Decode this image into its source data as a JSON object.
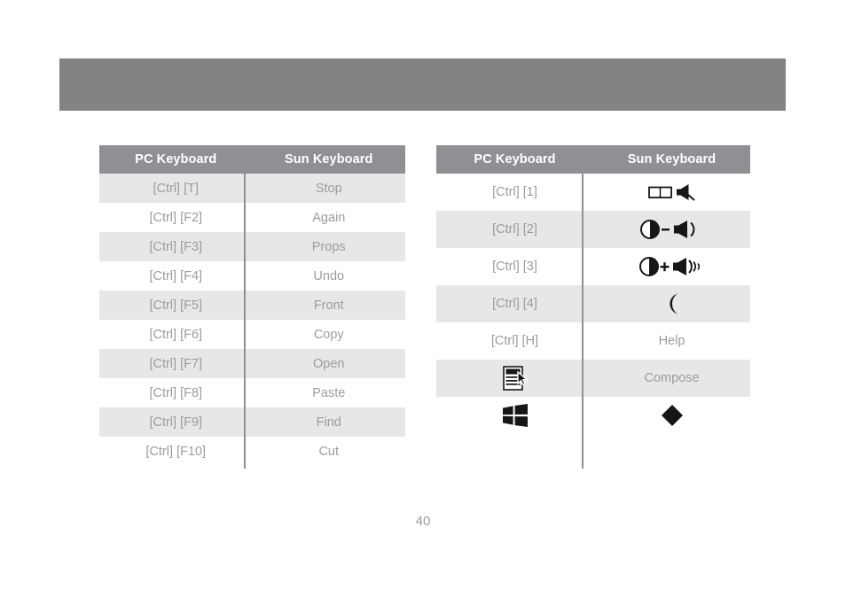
{
  "page": {
    "number": "40",
    "banner_color": "#818480",
    "header_bg": "#8e9094",
    "stripe_color": "#e5e7e9",
    "text_color": "#9c9c9c"
  },
  "tables": {
    "left": {
      "headers": [
        "PC Keyboard",
        "Sun Keyboard"
      ],
      "rows": [
        {
          "pc": "[Ctrl] [T]",
          "sun": "Stop"
        },
        {
          "pc": "[Ctrl] [F2]",
          "sun": "Again"
        },
        {
          "pc": "[Ctrl] [F3]",
          "sun": "Props"
        },
        {
          "pc": "[Ctrl] [F4]",
          "sun": "Undo"
        },
        {
          "pc": "[Ctrl] [F5]",
          "sun": "Front"
        },
        {
          "pc": "[Ctrl] [F6]",
          "sun": "Copy"
        },
        {
          "pc": "[Ctrl] [F7]",
          "sun": "Open"
        },
        {
          "pc": "[Ctrl] [F8]",
          "sun": "Paste"
        },
        {
          "pc": "[Ctrl] [F9]",
          "sun": "Find"
        },
        {
          "pc": "[Ctrl] [F10]",
          "sun": "Cut"
        }
      ]
    },
    "right": {
      "headers": [
        "PC Keyboard",
        "Sun Keyboard"
      ],
      "rows": [
        {
          "pc": "[Ctrl] [1]",
          "pc_icon": "",
          "sun": "",
          "sun_icon": "mute-speaker-icon"
        },
        {
          "pc": "[Ctrl] [2]",
          "pc_icon": "",
          "sun": "",
          "sun_icon": "volume-down-icon"
        },
        {
          "pc": "[Ctrl] [3]",
          "pc_icon": "",
          "sun": "",
          "sun_icon": "volume-up-icon"
        },
        {
          "pc": "[Ctrl] [4]",
          "pc_icon": "",
          "sun": "",
          "sun_icon": "crescent-moon-icon"
        },
        {
          "pc": "[Ctrl] [H]",
          "pc_icon": "",
          "sun": "Help",
          "sun_icon": ""
        },
        {
          "pc": "",
          "pc_icon": "application-menu-key-icon",
          "sun": "Compose",
          "sun_icon": ""
        },
        {
          "pc": "",
          "pc_icon": "windows-logo-key-icon",
          "sun": "",
          "sun_icon": "diamond-meta-key-icon"
        }
      ]
    }
  }
}
